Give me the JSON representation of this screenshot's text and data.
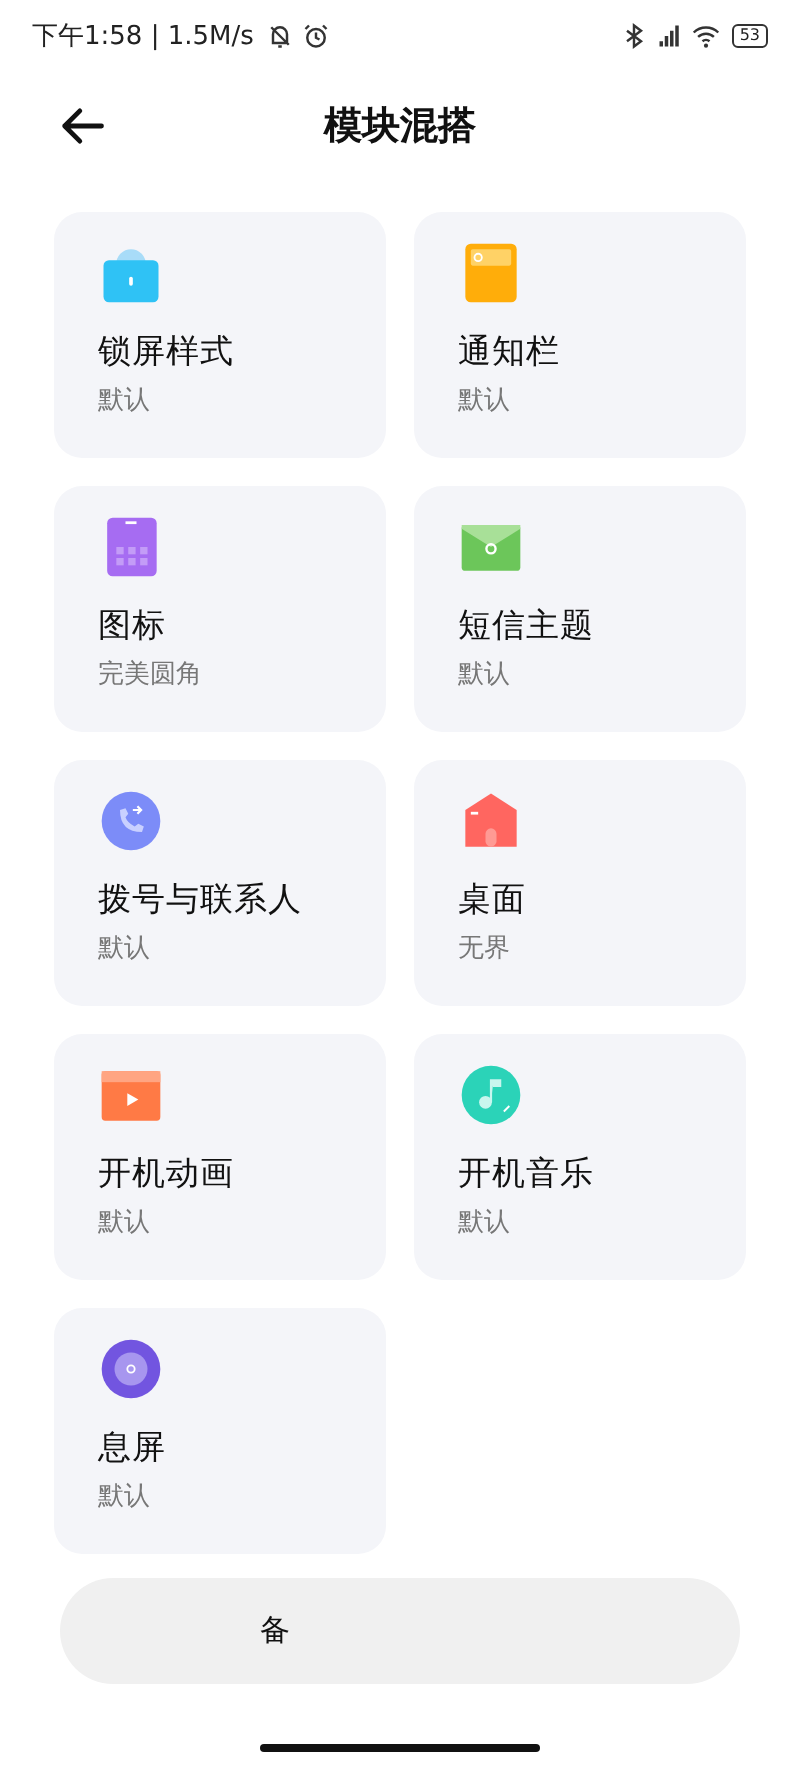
{
  "status_bar": {
    "time": "下午1:58 | 1.5M/s",
    "battery": "53"
  },
  "header": {
    "title": "模块混搭"
  },
  "modules": [
    {
      "kind": "lock",
      "name": "锁屏样式",
      "value": "默认"
    },
    {
      "kind": "notification",
      "name": "通知栏",
      "value": "默认"
    },
    {
      "kind": "icons",
      "name": "图标",
      "value": "完美圆角"
    },
    {
      "kind": "message",
      "name": "短信主题",
      "value": "默认"
    },
    {
      "kind": "dialer",
      "name": "拨号与联系人",
      "value": "默认"
    },
    {
      "kind": "home",
      "name": "桌面",
      "value": "无界"
    },
    {
      "kind": "boot_animation",
      "name": "开机动画",
      "value": "默认"
    },
    {
      "kind": "boot_music",
      "name": "开机音乐",
      "value": "默认"
    },
    {
      "kind": "aod",
      "name": "息屏",
      "value": "默认"
    }
  ],
  "bottom_button": {
    "label": "备"
  }
}
